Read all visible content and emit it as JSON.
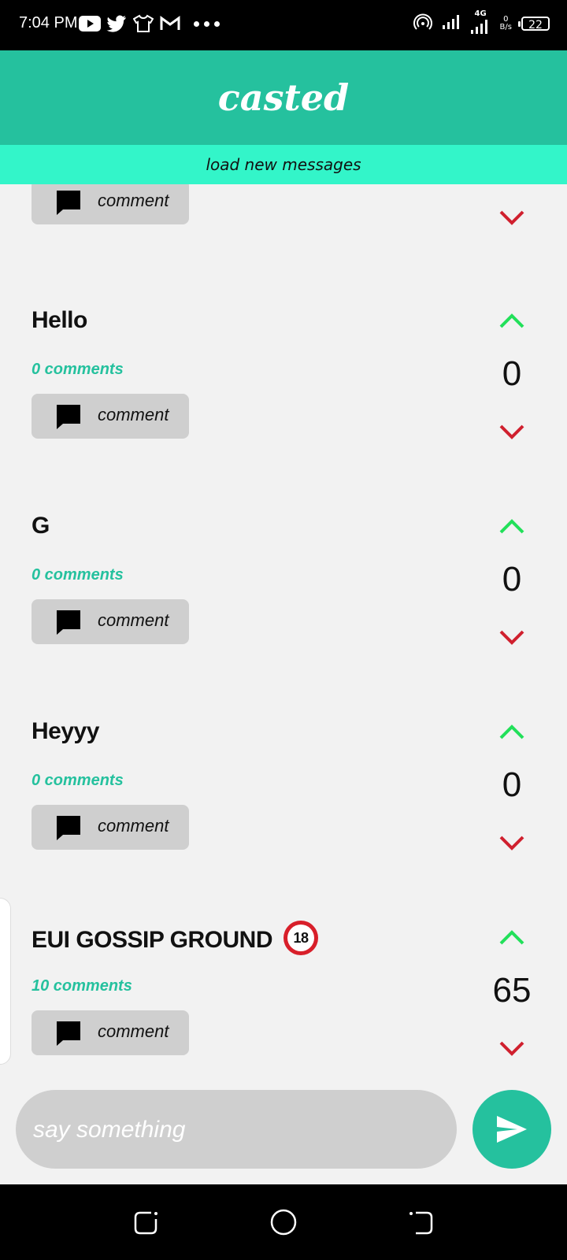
{
  "status_bar": {
    "time": "7:04 PM",
    "network": "4G",
    "speed_value": "0",
    "speed_unit": "B/s",
    "battery": "22",
    "left_icons": [
      "youtube-icon",
      "twitter-icon",
      "tshirt-icon",
      "gmail-icon"
    ],
    "right_icons": [
      "hotspot-icon",
      "signal-icon",
      "signal-4g-icon",
      "battery-icon"
    ]
  },
  "app": {
    "title": "casted",
    "load_label": "load new messages",
    "accent": "#25c19e",
    "load_bar_color": "#33f5c9"
  },
  "posts": [
    {
      "title": "",
      "comments": "",
      "button_label": "comment",
      "score": ""
    },
    {
      "title": "Hello",
      "comments": "0 comments",
      "button_label": "comment",
      "score": "0"
    },
    {
      "title": "G",
      "comments": "0 comments",
      "button_label": "comment",
      "score": "0"
    },
    {
      "title": "Heyyy",
      "comments": "0 comments",
      "button_label": "comment",
      "score": "0"
    },
    {
      "title": "EUI GOSSIP GROUND",
      "title_emoji": "18",
      "comments": "10 comments",
      "button_label": "comment",
      "score": "65"
    }
  ],
  "composer": {
    "placeholder": "say something",
    "value": ""
  },
  "vote_colors": {
    "up": "#22e05a",
    "down": "#d0202e"
  }
}
